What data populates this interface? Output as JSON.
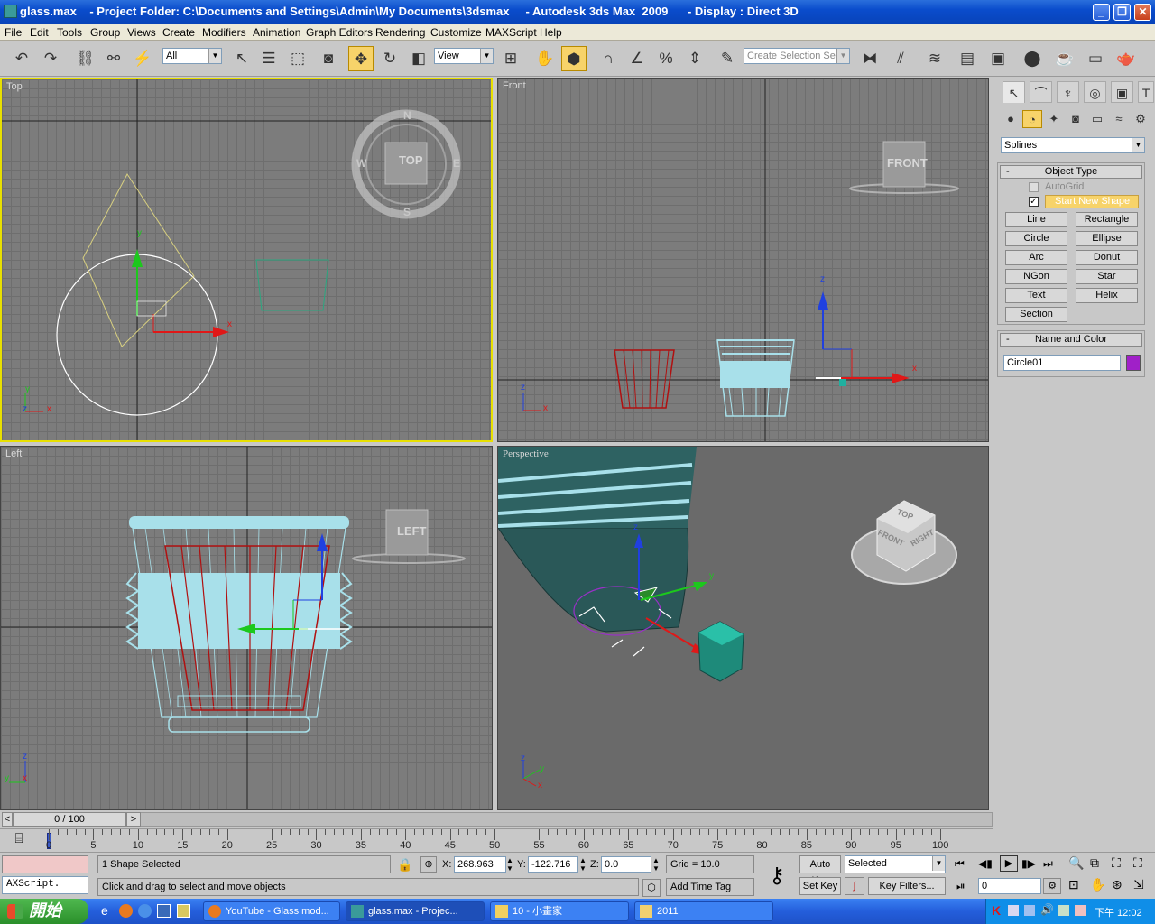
{
  "window": {
    "title": "glass.max    - Project Folder: C:\\Documents and Settings\\Admin\\My Documents\\3dsmax     - Autodesk 3ds Max  2009      - Display : Direct 3D",
    "minimize": "_",
    "maximize": "❐",
    "close": "✕"
  },
  "menu": [
    "File",
    "Edit",
    "Tools",
    "Group",
    "Views",
    "Create",
    "Modifiers",
    "Animation",
    "Graph Editors",
    "Rendering",
    "Customize",
    "MAXScript",
    "Help"
  ],
  "toolbar": {
    "selection_filter": "All",
    "ref_coord": "View",
    "named_selection_placeholder": "Create Selection Set"
  },
  "viewports": {
    "top": {
      "label": "Top",
      "nav_label": "TOP",
      "compass": [
        "N",
        "S",
        "E",
        "W"
      ]
    },
    "front": {
      "label": "Front",
      "nav_label": "FRONT"
    },
    "left": {
      "label": "Left",
      "nav_label": "LEFT"
    },
    "perspective": {
      "label": "Perspective",
      "cube_labels": [
        "TOP",
        "FRONT",
        "RIGHT"
      ]
    }
  },
  "axis_labels": {
    "x": "x",
    "y": "y",
    "z": "z"
  },
  "command_panel": {
    "category": "Splines",
    "object_type_title": "Object Type",
    "autogrid": "AutoGrid",
    "start_new_shape": "Start New Shape",
    "start_new_shape_checked": true,
    "buttons": [
      "Line",
      "Rectangle",
      "Circle",
      "Ellipse",
      "Arc",
      "Donut",
      "NGon",
      "Star",
      "Text",
      "Helix",
      "Section"
    ],
    "name_color_title": "Name and Color",
    "object_name": "Circle01",
    "object_color": "#a020c8"
  },
  "time_slider": {
    "label": "0 / 100",
    "prev": "<",
    "next": ">"
  },
  "track": {
    "ticks": [
      "0",
      "5",
      "10",
      "15",
      "20",
      "25",
      "30",
      "35",
      "40",
      "45",
      "50",
      "55",
      "60",
      "65",
      "70",
      "75",
      "80",
      "85",
      "90",
      "95",
      "100"
    ]
  },
  "status": {
    "maxscript": "AXScript.",
    "selection": "1 Shape Selected",
    "prompt": "Click and drag to select and move objects",
    "x_label": "X:",
    "x_value": "268.963",
    "y_label": "Y:",
    "y_value": "-122.716",
    "z_label": "Z:",
    "z_value": "0.0",
    "grid": "Grid = 10.0",
    "add_time_tag": "Add Time Tag",
    "auto_key": "Auto Key",
    "set_key": "Set Key",
    "key_mode": "Selected",
    "key_filters": "Key Filters...",
    "frame": "0"
  },
  "taskbar": {
    "start": "開始",
    "tasks": [
      "YouTube - Glass mod...",
      "glass.max     - Projec...",
      "10 - 小畫家",
      "2011"
    ],
    "clock": "下午 12:02"
  }
}
